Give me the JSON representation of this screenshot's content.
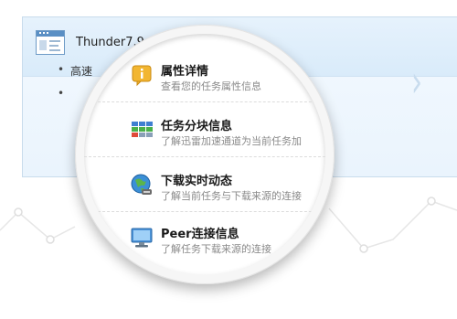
{
  "app": {
    "title": "Thunder7.9",
    "bullets": [
      "高速",
      " "
    ]
  },
  "magnifier": {
    "items": [
      {
        "title": "属性详情",
        "description": "查看您的任务属性信息",
        "icon": "info-icon"
      },
      {
        "title": "任务分块信息",
        "description": "了解迅雷加速通道为当前任务加",
        "icon": "blocks-icon"
      },
      {
        "title": "下载实时动态",
        "description": "了解当前任务与下载来源的连接",
        "icon": "globe-icon"
      },
      {
        "title": "Peer连接信息",
        "description": "了解任务下载来源的连接",
        "icon": "monitor-icon"
      }
    ]
  },
  "colors": {
    "accent": "#5a8fc4",
    "panel_bg": "#eaf4fd",
    "lens_border": "#f6f6f6"
  }
}
